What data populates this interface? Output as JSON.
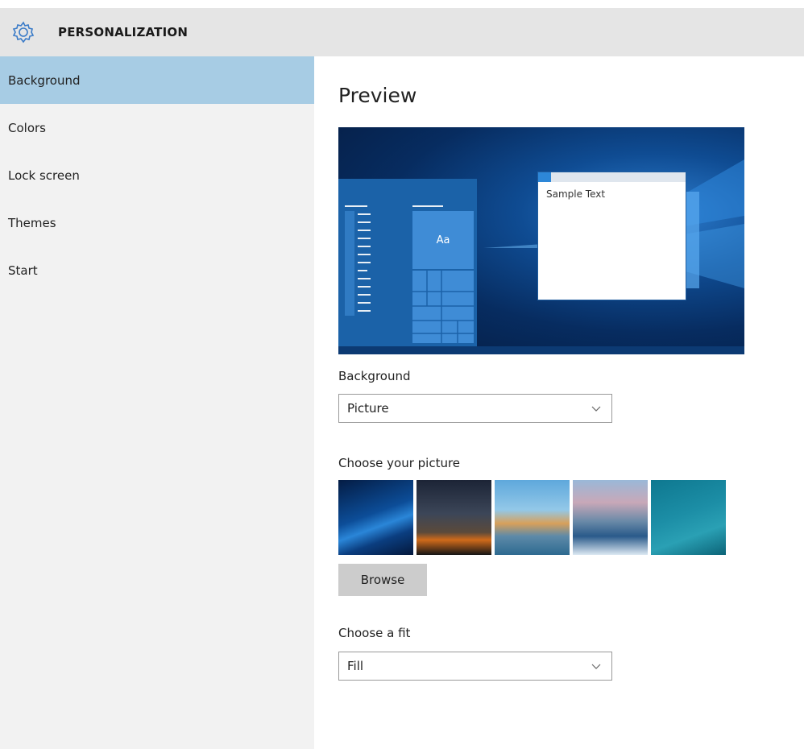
{
  "header": {
    "title": "PERSONALIZATION",
    "icon": "gear-icon"
  },
  "sidebar": {
    "items": [
      {
        "label": "Background",
        "selected": true
      },
      {
        "label": "Colors"
      },
      {
        "label": "Lock screen"
      },
      {
        "label": "Themes"
      },
      {
        "label": "Start"
      }
    ]
  },
  "main": {
    "heading": "Preview",
    "preview": {
      "sample_text": "Sample Text",
      "tile_label": "Aa"
    },
    "background_label": "Background",
    "background_value": "Picture",
    "choose_picture_label": "Choose your picture",
    "browse_label": "Browse",
    "fit_label": "Choose a fit",
    "fit_value": "Fill"
  },
  "colors": {
    "accent": "#a7cce4",
    "sidebar_bg": "#f2f2f2",
    "header_bg": "#e5e5e5"
  }
}
